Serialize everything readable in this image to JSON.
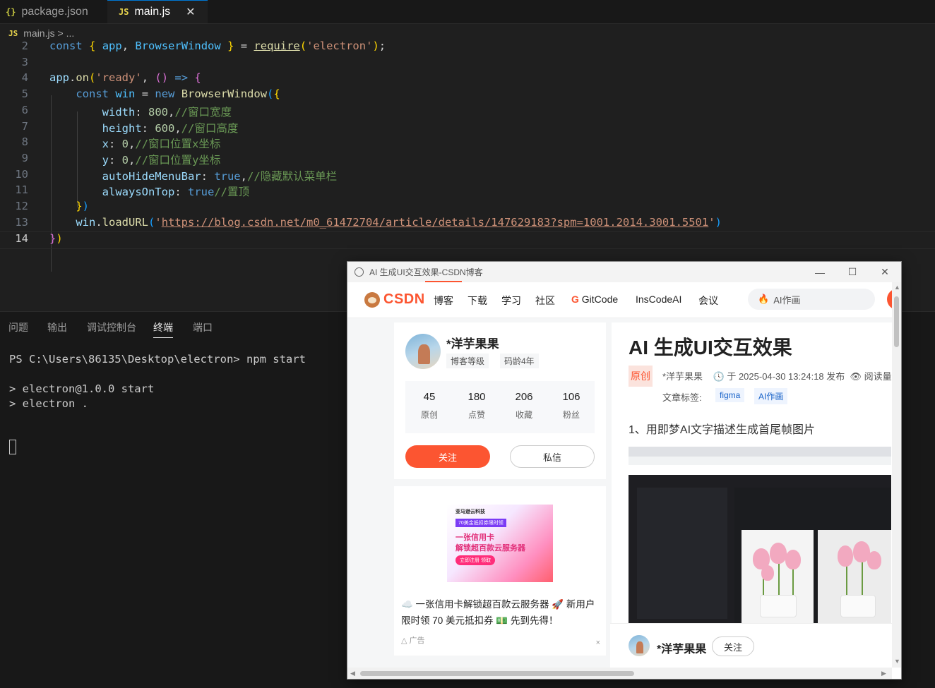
{
  "tabs": [
    {
      "icon": "{}",
      "icon_name": "json-file-icon",
      "label": "package.json"
    },
    {
      "icon": "JS",
      "icon_name": "js-file-icon",
      "label": "main.js",
      "close": "✕"
    }
  ],
  "breadcrumb": {
    "icon": "JS",
    "file": "main.js",
    "rest": "> ..."
  },
  "editor": {
    "line_numbers": [
      "2",
      "3",
      "4",
      "5",
      "6",
      "7",
      "8",
      "9",
      "10",
      "11",
      "12",
      "13",
      "14"
    ],
    "tokens": {
      "const": "const",
      "app": "app",
      "BrowserWindow": "BrowserWindow",
      "require": "require",
      "electron_str": "'electron'",
      "on": "on",
      "ready_str": "'ready'",
      "arrow": "=>",
      "win": "win",
      "new": "new",
      "width_key": "width",
      "width_val": "800",
      "width_comment": "//窗口宽度",
      "height_key": "height",
      "height_val": "600",
      "height_comment": "//窗口高度",
      "x_key": "x",
      "x_val": "0",
      "x_comment": "//窗口位置x坐标",
      "y_key": "y",
      "y_val": "0",
      "y_comment": "//窗口位置y坐标",
      "autohide_key": "autoHideMenuBar",
      "autohide_val": "true",
      "autohide_comment": "//隐藏默认菜单栏",
      "ontop_key": "alwaysOnTop",
      "ontop_val": "true",
      "ontop_comment": "//置顶",
      "loadURL": "loadURL",
      "url": "https://blog.csdn.net/m0_61472704/article/details/147629183?spm=1001.2014.3001.5501"
    }
  },
  "panel": {
    "tabs": [
      "问题",
      "输出",
      "调试控制台",
      "终端",
      "端口"
    ],
    "active_tab": "终端",
    "terminal_lines": [
      "PS C:\\Users\\86135\\Desktop\\electron> npm start",
      "",
      "> electron@1.0.0 start",
      "> electron ."
    ]
  },
  "window": {
    "title": "AI 生成UI交互效果-CSDN博客",
    "controls": [
      "—",
      "☐",
      "✕"
    ],
    "nav": {
      "logo": "CSDN",
      "items": [
        "博客",
        "下载",
        "学习",
        "社区",
        "GitCode",
        "InsCodeAI",
        "会议"
      ],
      "gitcode_mark": "G",
      "search_placeholder": "AI作画"
    },
    "profile": {
      "name": "*洋芋果果",
      "level_label": "博客等级",
      "age_label": "码龄4年",
      "stats": [
        {
          "value": "45",
          "label": "原创"
        },
        {
          "value": "180",
          "label": "点赞"
        },
        {
          "value": "206",
          "label": "收藏"
        },
        {
          "value": "106",
          "label": "粉丝"
        }
      ],
      "follow": "关注",
      "message": "私信"
    },
    "ad": {
      "brand": "亚马逊云科技",
      "badge": "70美金抵扣券限时领",
      "headline1": "一张信用卡",
      "headline2": "解锁超百款云服务器",
      "cta": "立即注册 领取",
      "text": "☁️ 一张信用卡解锁超百款云服务器 🚀 新用户限时领 70 美元抵扣券 💵 先到先得！",
      "footer": "广告",
      "close": "×"
    },
    "article": {
      "title": "AI 生成UI交互效果",
      "original_badge": "原创",
      "author": "*洋芋果果",
      "date": "于 2025-04-30 13:24:18 发布",
      "reads": "阅读量",
      "tags_label": "文章标签:",
      "tags": [
        "figma",
        "AI作画"
      ],
      "section": "1、用即梦AI文字描述生成首尾帧图片"
    },
    "author_bar": {
      "name": "*洋芋果果",
      "follow": "关注"
    }
  }
}
